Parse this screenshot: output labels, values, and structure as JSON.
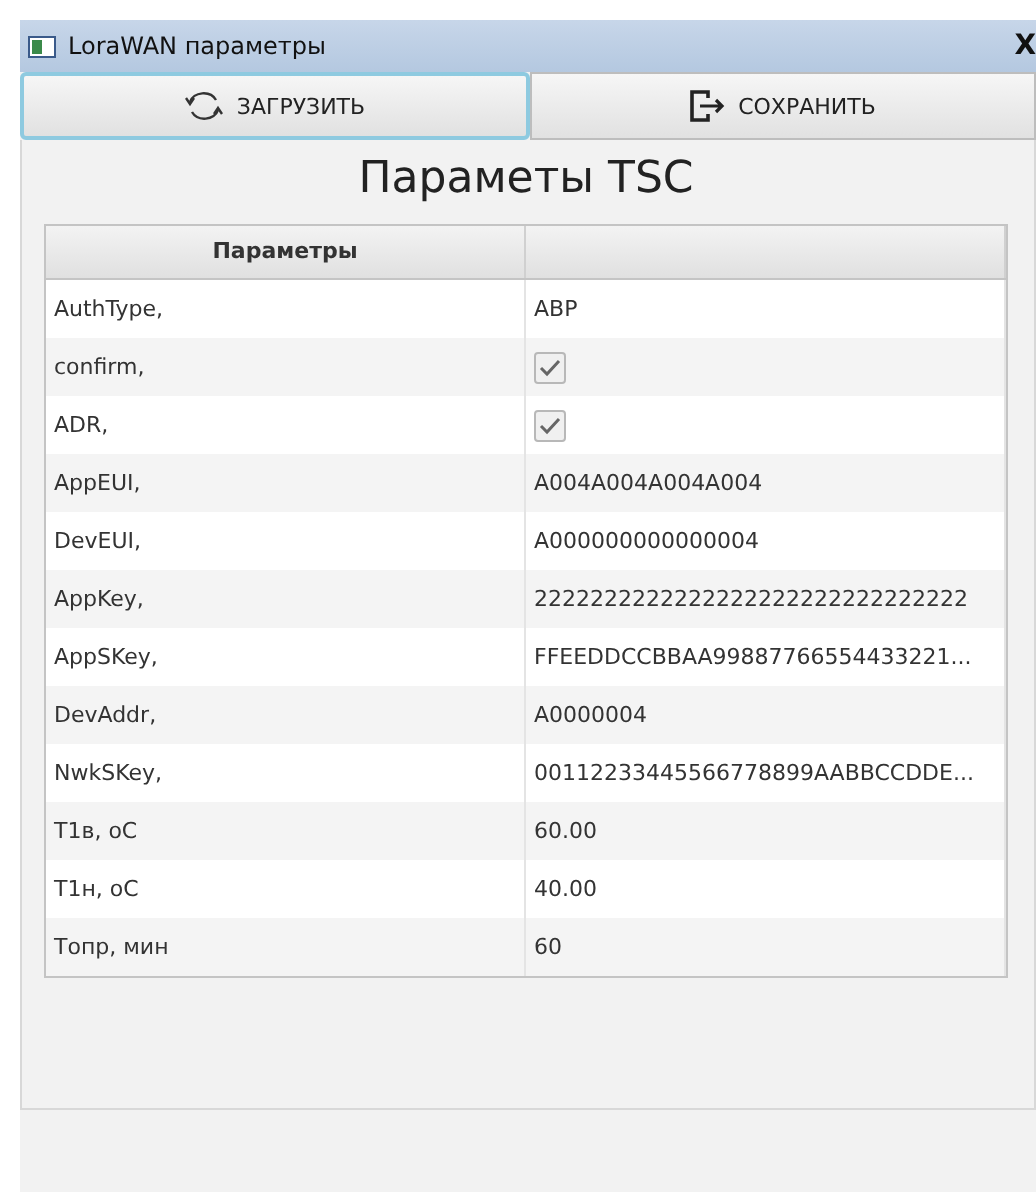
{
  "window": {
    "title": "LoraWAN параметры",
    "close": "X"
  },
  "toolbar": [
    {
      "label": "ЗАГРУЗИТЬ",
      "kind": "load",
      "focused": true
    },
    {
      "label": "СОХРАНИТЬ",
      "kind": "save",
      "focused": false
    }
  ],
  "heading": "Параметы TSC",
  "table": {
    "columns": [
      "Параметры",
      ""
    ],
    "rows": [
      {
        "name": "AuthType,",
        "kind": "text",
        "value": "ABP"
      },
      {
        "name": "confirm,",
        "kind": "checkbox",
        "checked": true
      },
      {
        "name": "ADR,",
        "kind": "checkbox",
        "checked": true
      },
      {
        "name": "AppEUI,",
        "kind": "text",
        "value": "A004A004A004A004"
      },
      {
        "name": "DevEUI,",
        "kind": "text",
        "value": "A000000000000004"
      },
      {
        "name": "AppKey,",
        "kind": "text",
        "value": "2222222222222222222222222222222"
      },
      {
        "name": "AppSKey,",
        "kind": "text",
        "value": "FFEEDDCCBBAA99887766554433221..."
      },
      {
        "name": "DevAddr,",
        "kind": "text",
        "value": "A0000004"
      },
      {
        "name": "NwkSKey,",
        "kind": "text",
        "value": "00112233445566778899AABBCCDDE..."
      },
      {
        "name": "T1в, оС",
        "kind": "text",
        "value": "60.00"
      },
      {
        "name": "T1н, оС",
        "kind": "text",
        "value": "40.00"
      },
      {
        "name": "Топр, мин",
        "kind": "text",
        "value": "60"
      }
    ]
  }
}
